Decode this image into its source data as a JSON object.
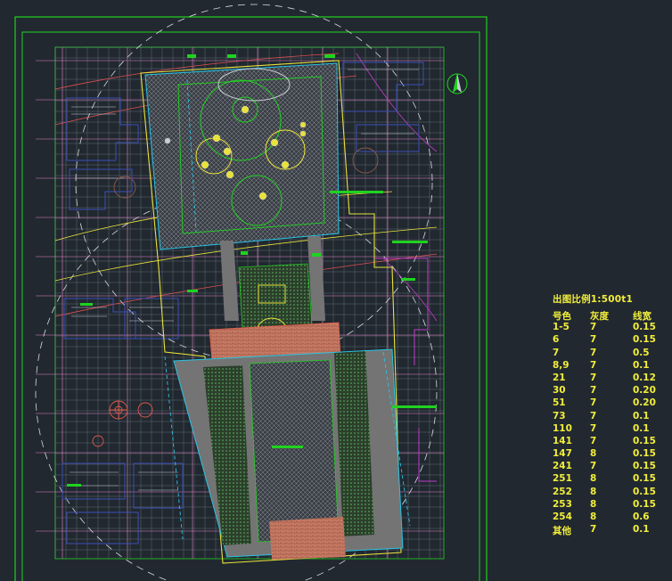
{
  "drawing": {
    "colors": {
      "background": "#212830",
      "frame": "#1fd31f",
      "grid_pink": "#e884c8",
      "grid_white": "#c8ccd4",
      "site_yellow": "#e8e23a",
      "site_cyan": "#27c4e4",
      "paving": "#747474",
      "building_blue": "#3a4fb6",
      "pavilion_red": "#e05a4a",
      "magenta": "#c03cc8",
      "north_arrow": "#1fd31f"
    },
    "icons": [
      "north-arrow-icon",
      "tree-symbol-icon",
      "fountain-icon"
    ]
  },
  "legend": {
    "scale_label": "出图比例1:500t1",
    "headers": [
      "号色",
      "灰度",
      "线宽"
    ],
    "rows": [
      {
        "color": "1-5",
        "gray": "7",
        "width": "0.15"
      },
      {
        "color": "6",
        "gray": "7",
        "width": "0.15"
      },
      {
        "color": "7",
        "gray": "7",
        "width": "0.5"
      },
      {
        "color": "8,9",
        "gray": "7",
        "width": "0.1"
      },
      {
        "color": "21",
        "gray": "7",
        "width": "0.12"
      },
      {
        "color": "30",
        "gray": "7",
        "width": "0.20"
      },
      {
        "color": "51",
        "gray": "7",
        "width": "0.20"
      },
      {
        "color": "73",
        "gray": "7",
        "width": "0.1"
      },
      {
        "color": "110",
        "gray": "7",
        "width": "0.1"
      },
      {
        "color": "141",
        "gray": "7",
        "width": "0.15"
      },
      {
        "color": "147",
        "gray": "8",
        "width": "0.15"
      },
      {
        "color": "241",
        "gray": "7",
        "width": "0.15"
      },
      {
        "color": "251",
        "gray": "8",
        "width": "0.15"
      },
      {
        "color": "252",
        "gray": "8",
        "width": "0.15"
      },
      {
        "color": "253",
        "gray": "8",
        "width": "0.15"
      },
      {
        "color": "254",
        "gray": "8",
        "width": "0.6"
      },
      {
        "color": "其他",
        "gray": "7",
        "width": "0.1"
      }
    ]
  }
}
